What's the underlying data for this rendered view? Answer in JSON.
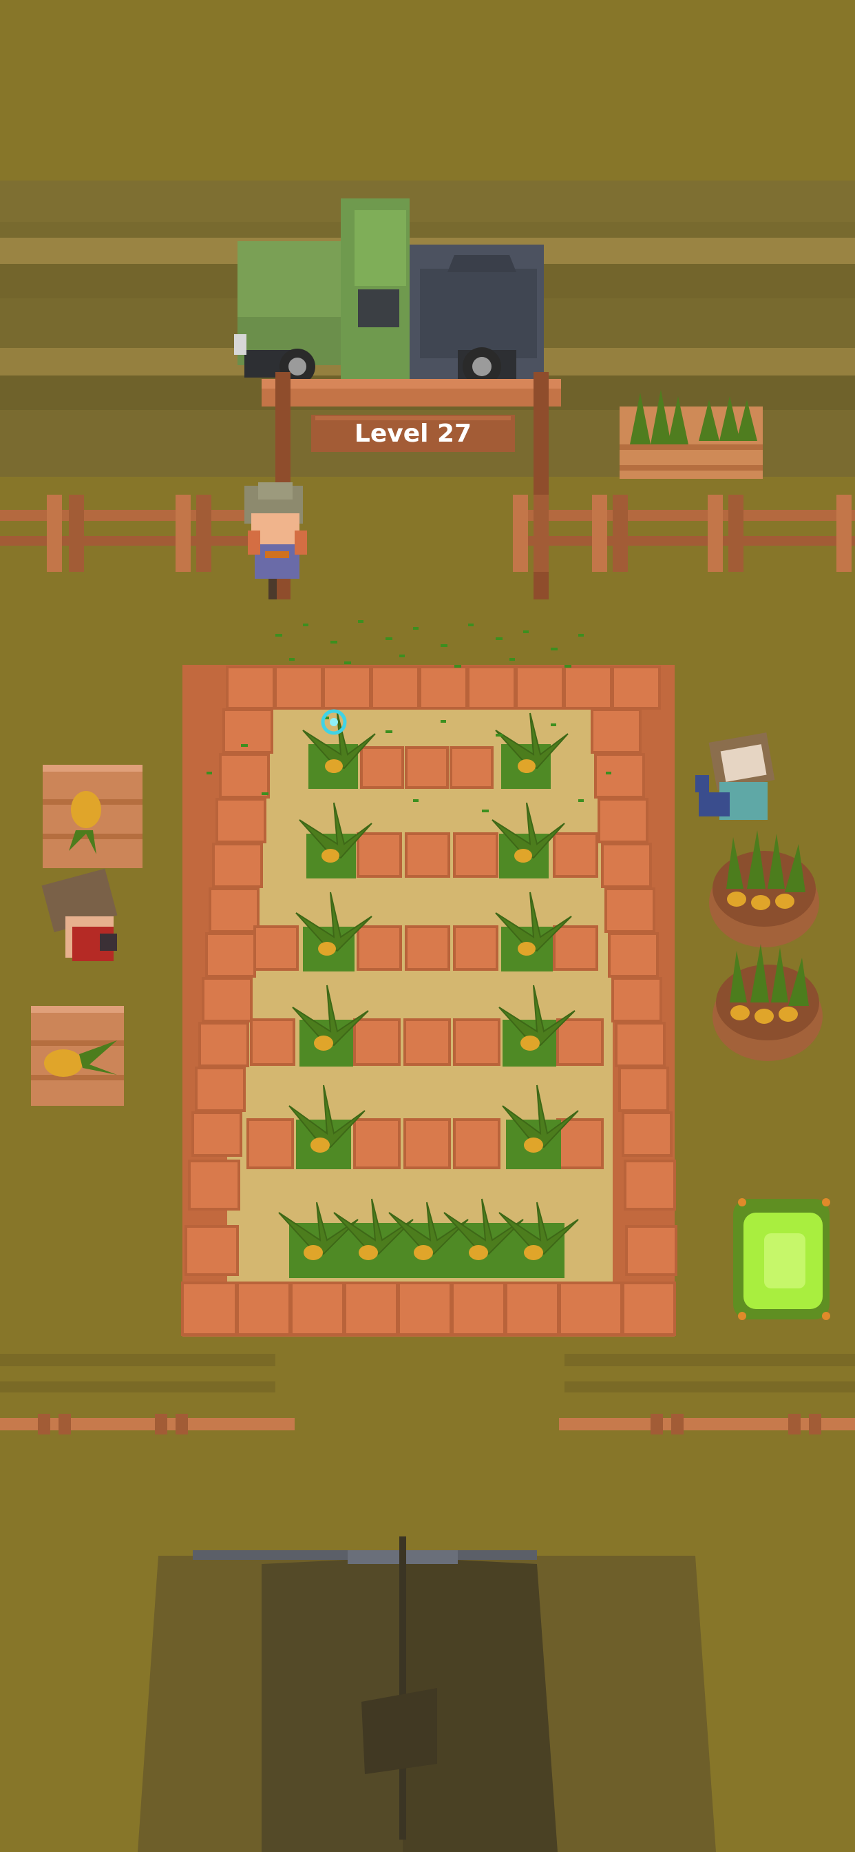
{
  "hud": {
    "level_label": "Level 27"
  },
  "colors": {
    "ground": "#877629",
    "road": "#776a2f",
    "soil": "#d4b770",
    "brick": "#d7774a",
    "leaf": "#4e7d1e",
    "truck_green": "#7aa055",
    "truck_dark": "#4c5260",
    "sign_wood": "#a35c36",
    "fence_wood": "#b4693f",
    "bin_lime": "#a9ee3f"
  },
  "scene": {
    "field": {
      "rows": 6,
      "cols": 2,
      "bottom_row_plants": 5
    },
    "objects": [
      "truck",
      "level-sign",
      "fence",
      "farmer",
      "crates",
      "workers",
      "baskets",
      "lime-bin",
      "barn-roof"
    ]
  }
}
